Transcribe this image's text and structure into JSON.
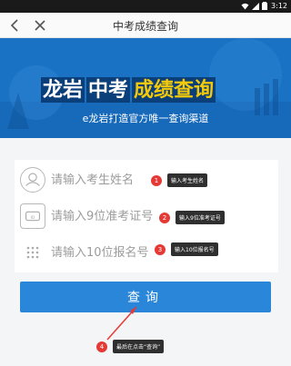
{
  "status_bar": {
    "time": "3:12"
  },
  "nav": {
    "title": "中考成绩查询"
  },
  "banner": {
    "title_part1": "龙岩",
    "title_part2": "中考",
    "title_part3": "成绩查询",
    "slogan": "e龙岩打造官方唯一查询渠道"
  },
  "form": {
    "name_placeholder": "请输入考生姓名",
    "exam_no_placeholder": "请输入9位准考证号",
    "reg_no_placeholder": "请输入10位报名号",
    "submit_label": "查询"
  },
  "callouts": [
    {
      "num": "1",
      "label": "输入考生姓名"
    },
    {
      "num": "2",
      "label": "输入9位准考证号"
    },
    {
      "num": "3",
      "label": "输入10位报名号"
    },
    {
      "num": "4",
      "label": "最后在点击“查询”"
    }
  ],
  "colors": {
    "accent": "#2a86d8",
    "banner_bg": "#1a72c4",
    "highlight_yellow": "#f4c90a",
    "callout_red": "#e53935"
  }
}
